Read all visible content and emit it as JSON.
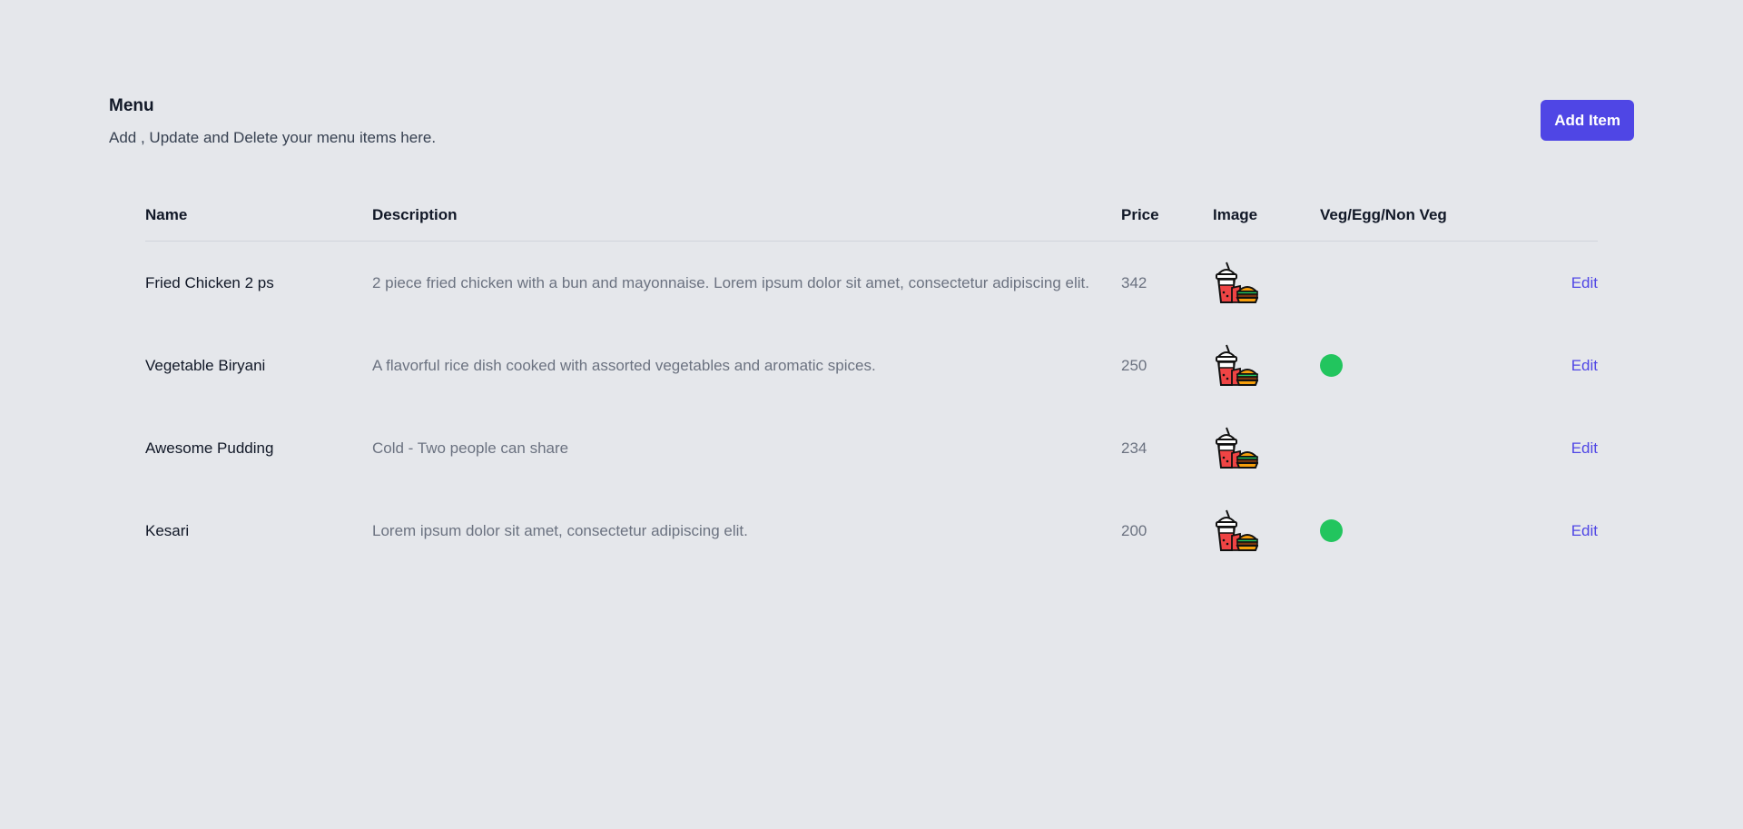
{
  "header": {
    "title": "Menu",
    "subtitle": "Add , Update and Delete your menu items here.",
    "add_button_label": "Add Item"
  },
  "table": {
    "columns": {
      "name": "Name",
      "description": "Description",
      "price": "Price",
      "image": "Image",
      "veg": "Veg/Egg/Non Veg"
    },
    "edit_label": "Edit",
    "rows": [
      {
        "name": "Fried Chicken 2 ps",
        "description": "2 piece fried chicken with a bun and mayonnaise. Lorem ipsum dolor sit amet, consectetur adipiscing elit.",
        "price": "342",
        "image_icon": "food-combo-icon",
        "veg_indicator": false
      },
      {
        "name": "Vegetable Biryani",
        "description": "A flavorful rice dish cooked with assorted vegetables and aromatic spices.",
        "price": "250",
        "image_icon": "food-combo-icon",
        "veg_indicator": true
      },
      {
        "name": "Awesome Pudding",
        "description": "Cold - Two people can share",
        "price": "234",
        "image_icon": "food-combo-icon",
        "veg_indicator": false
      },
      {
        "name": "Kesari",
        "description": "Lorem ipsum dolor sit amet, consectetur adipiscing elit.",
        "price": "200",
        "image_icon": "food-combo-icon",
        "veg_indicator": true
      }
    ]
  },
  "colors": {
    "background": "#e5e7eb",
    "accent": "#4f46e5",
    "veg_green": "#22c55e"
  }
}
